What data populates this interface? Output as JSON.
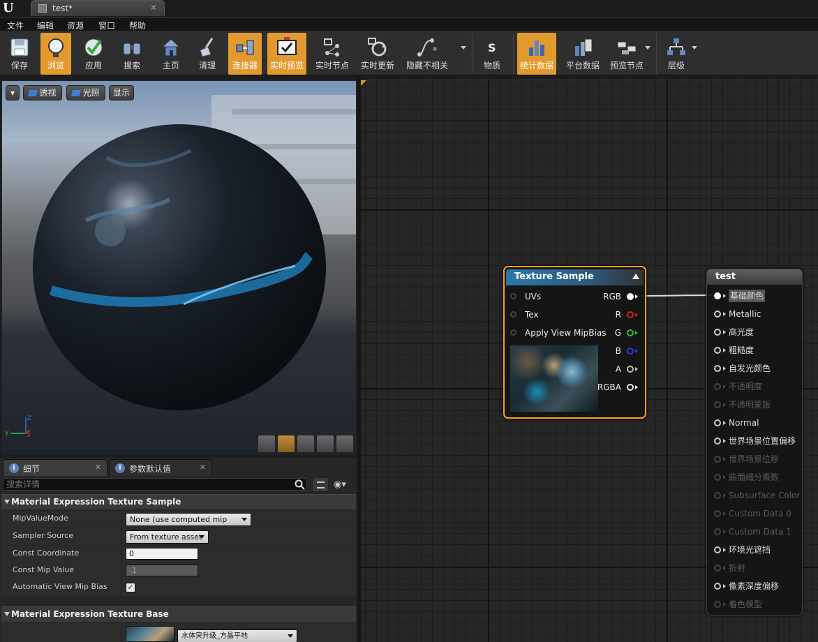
{
  "window": {
    "tab_title": "test*"
  },
  "menu": [
    "文件",
    "编辑",
    "资源",
    "窗口",
    "帮助"
  ],
  "toolbar": {
    "save": "保存",
    "browse": "浏览",
    "apply": "应用",
    "search": "搜索",
    "home": "主页",
    "clean": "清理",
    "connectors": "连接器",
    "live_preview": "实时预览",
    "live_nodes": "实时节点",
    "live_update": "实时更新",
    "hide_unrelated": "隐藏不相关",
    "material": "物质",
    "stats": "统计数据",
    "platform_stats": "平台数据",
    "preview_nodes": "预览节点",
    "hierarchy": "层级"
  },
  "viewport": {
    "perspective": "透视",
    "lighting": "光照",
    "show": "显示"
  },
  "details": {
    "tab_details": "细节",
    "tab_params": "参数默认值",
    "search_placeholder": "搜索详情",
    "category1": "Material Expression Texture Sample",
    "props": [
      {
        "name": "MipValueMode",
        "value": "None (use computed mip level)"
      },
      {
        "name": "Sampler Source",
        "value": "From texture asset"
      },
      {
        "name": "Const Coordinate",
        "value": "0"
      },
      {
        "name": "Const Mip Value",
        "value": "-1"
      },
      {
        "name": "Automatic View Mip Bias",
        "value": "✓"
      }
    ],
    "category2": "Material Expression Texture Base",
    "texture_asset": "水体突升级_方晶平地"
  },
  "graph": {
    "texture_node": {
      "title": "Texture Sample",
      "inputs": [
        "UVs",
        "Tex",
        "Apply View MipBias"
      ],
      "outputs": [
        "RGB",
        "R",
        "G",
        "B",
        "A",
        "RGBA"
      ]
    },
    "result_node": {
      "title": "test",
      "pins": [
        {
          "label": "基础颜色",
          "enabled": true
        },
        {
          "label": "Metallic",
          "enabled": true
        },
        {
          "label": "高光度",
          "enabled": true
        },
        {
          "label": "粗糙度",
          "enabled": true
        },
        {
          "label": "自发光颜色",
          "enabled": true
        },
        {
          "label": "不透明度",
          "enabled": false
        },
        {
          "label": "不透明蒙版",
          "enabled": false
        },
        {
          "label": "Normal",
          "enabled": true
        },
        {
          "label": "世界场景位置偏移",
          "enabled": true
        },
        {
          "label": "世界场景位移",
          "enabled": false
        },
        {
          "label": "曲面细分乘数",
          "enabled": false
        },
        {
          "label": "Subsurface Color",
          "enabled": false
        },
        {
          "label": "Custom Data 0",
          "enabled": false
        },
        {
          "label": "Custom Data 1",
          "enabled": false
        },
        {
          "label": "环境光遮挡",
          "enabled": true
        },
        {
          "label": "折射",
          "enabled": false
        },
        {
          "label": "像素深度偏移",
          "enabled": true
        },
        {
          "label": "着色模型",
          "enabled": false
        }
      ]
    }
  },
  "colors": {
    "accent": "#e29a2f",
    "node_border": "#f2a21a",
    "pin_r": "#d81f1f",
    "pin_g": "#22c42b",
    "pin_b": "#2b3de0"
  }
}
